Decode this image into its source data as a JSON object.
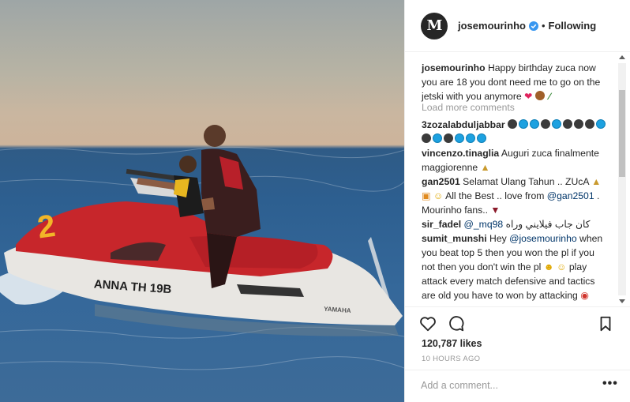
{
  "header": {
    "username": "josemourinho",
    "avatar_letter": "M",
    "separator": "•",
    "follow_status": "Following"
  },
  "photo": {
    "hull_text": "ANNA TH 19B",
    "brand_text": "YAMAHA",
    "number": "2"
  },
  "caption": {
    "username": "josemourinho",
    "text": "Happy birthday zuca now you are 18 you dont need me to go on the jetski with you anymore"
  },
  "load_more": "Load more comments",
  "comments": [
    {
      "username": "3zozalabduljabbar",
      "text": ""
    },
    {
      "username": "vincenzo.tinaglia",
      "text": "Auguri zuca finalmente maggiorenne"
    },
    {
      "username": "gan2501",
      "text": "Selamat Ulang Tahun .. ZUcA",
      "text2": "All the Best .. love from",
      "mention": "@gan2501",
      "text3": ". Mourinho fans.."
    },
    {
      "username": "sir_fadel",
      "mention": "@_mq98",
      "text": "كان جاب فيلايني وراه"
    },
    {
      "username": "sumit_munshi",
      "pre": "Hey",
      "mention": "@josemourinho",
      "text": "when you beat top 5 then you won the pl if you not then you don't win the pl",
      "text2": "play attack every match defensive and tactics are old you have to won by attacking"
    }
  ],
  "likes": "120,787 likes",
  "time_ago": "10 HOURS AGO",
  "add_comment": {
    "placeholder": "Add a comment..."
  },
  "more_label": "•••",
  "icons": [
    "heart-icon",
    "comment-icon",
    "bookmark-icon",
    "verified-badge-icon"
  ],
  "colors": {
    "link": "#003569",
    "muted": "#999999",
    "verified": "#3897f0",
    "text": "#262626"
  }
}
